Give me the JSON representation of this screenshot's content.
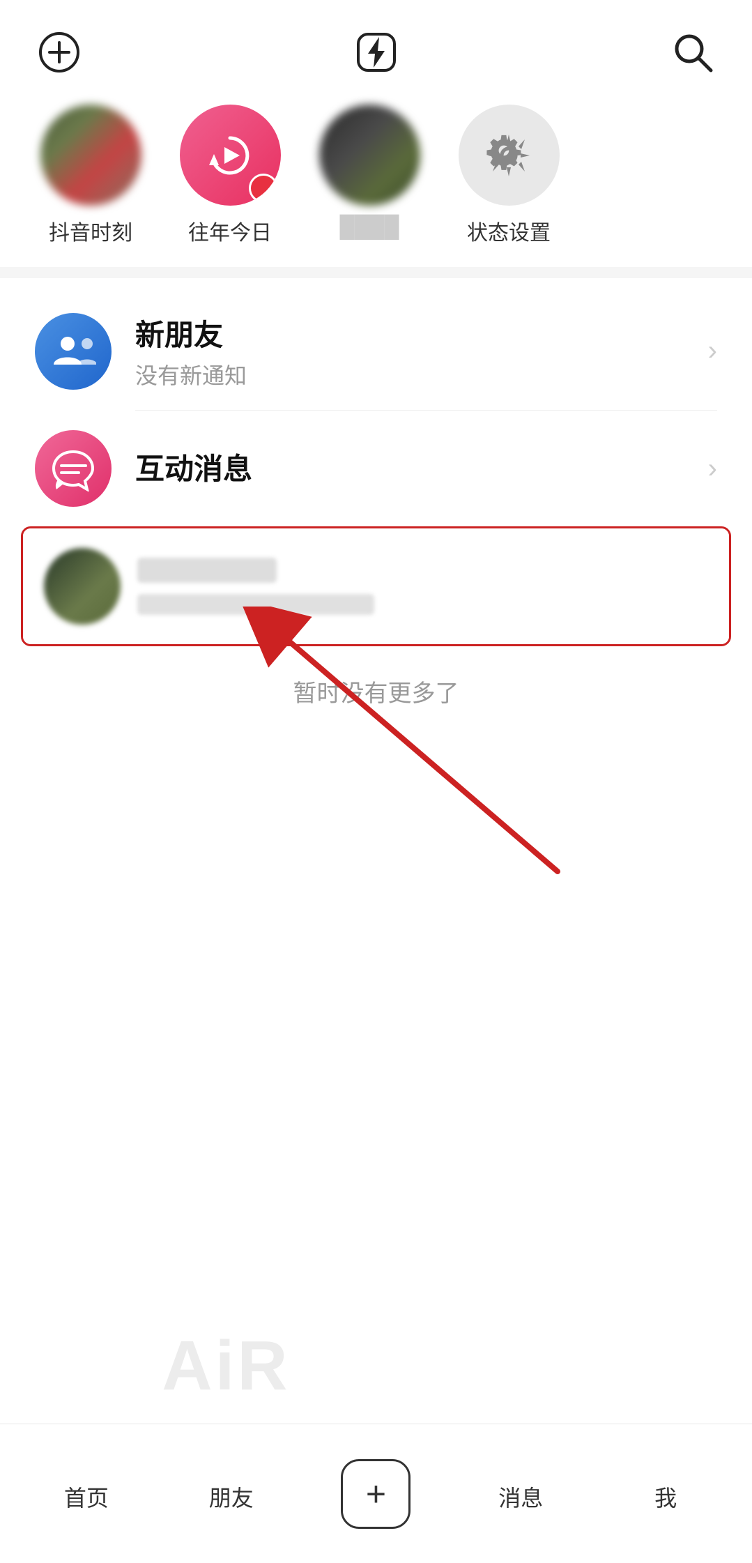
{
  "header": {
    "add_label": "+",
    "lightning_label": "⚡",
    "search_label": "🔍"
  },
  "stories": [
    {
      "id": "story1",
      "label": "抖音时刻",
      "type": "blurred"
    },
    {
      "id": "story2",
      "label": "往年今日",
      "type": "pink"
    },
    {
      "id": "story3",
      "label": "████",
      "type": "blurred2"
    },
    {
      "id": "story4",
      "label": "状态设置",
      "type": "gear"
    }
  ],
  "list_items": [
    {
      "id": "new-friends",
      "icon_type": "blue",
      "title": "新朋友",
      "subtitle": "没有新通知",
      "has_chevron": true
    },
    {
      "id": "interactive-messages",
      "icon_type": "pink",
      "title": "互动消息",
      "subtitle": "",
      "has_chevron": true
    }
  ],
  "chat_item": {
    "name_blurred": true,
    "preview_blurred": true
  },
  "no_more_text": "暂时没有更多了",
  "bottom_nav": {
    "items": [
      {
        "id": "home",
        "label": "首页"
      },
      {
        "id": "friends",
        "label": "朋友"
      },
      {
        "id": "add",
        "label": ""
      },
      {
        "id": "messages",
        "label": "消息"
      },
      {
        "id": "me",
        "label": "我"
      }
    ]
  },
  "watermark": {
    "text": "AiR"
  }
}
